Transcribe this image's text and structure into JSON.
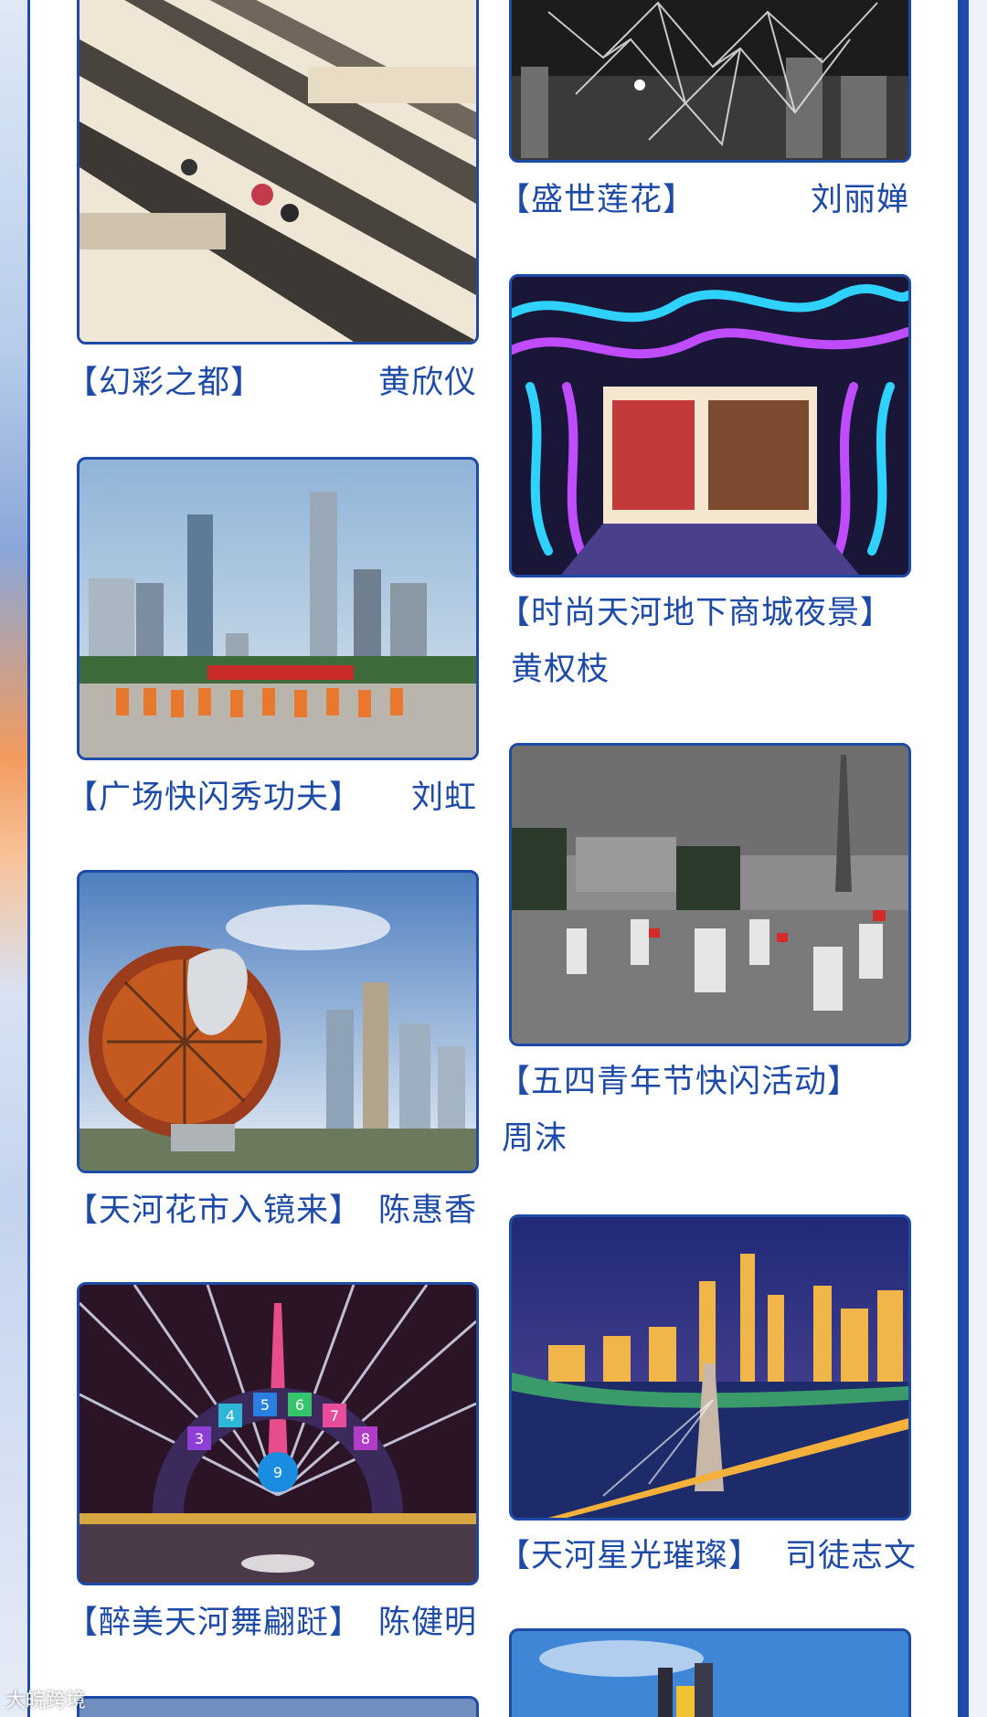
{
  "theme": {
    "accent": "#1e4aa8",
    "background": "#ffffff"
  },
  "left_column": [
    {
      "title": "【幻彩之都】",
      "author": "黄欣仪",
      "image": "mall-escalators-photo"
    },
    {
      "title": "【广场快闪秀功夫】",
      "author": "刘虹",
      "image": "plaza-kungfu-photo"
    },
    {
      "title": "【天河花市入镜来】",
      "author": "陈惠香",
      "image": "flower-sculpture-photo"
    },
    {
      "title": "【醉美天河舞翩跹】",
      "author": "陈健明",
      "image": "canton-tower-stage-photo"
    }
  ],
  "right_column": [
    {
      "title": "【盛世莲花】",
      "author": "刘丽婵",
      "image": "lotus-structure-photo"
    },
    {
      "title": "【时尚天河地下商城夜景】",
      "author": "黄权枝",
      "image": "neon-underground-mall-photo"
    },
    {
      "title": "【五四青年节快闪活动】",
      "author": "周沫",
      "image": "youth-day-flashmob-photo"
    },
    {
      "title": "【天河星光璀璨】",
      "author": "司徒志文",
      "image": "city-night-skyline-photo"
    }
  ],
  "stage_numbers": [
    "3",
    "4",
    "5",
    "6",
    "7",
    "8",
    "9"
  ],
  "watermark": "大皖跨境"
}
